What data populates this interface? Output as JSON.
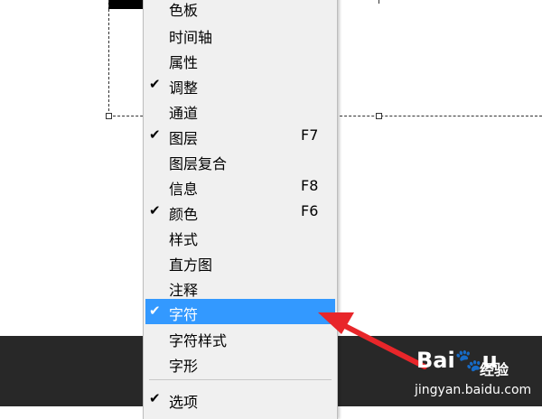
{
  "menu": {
    "items": [
      {
        "label": "色板",
        "checked": false,
        "shortcut": ""
      },
      {
        "label": "时间轴",
        "checked": false,
        "shortcut": ""
      },
      {
        "label": "属性",
        "checked": false,
        "shortcut": ""
      },
      {
        "label": "调整",
        "checked": true,
        "shortcut": ""
      },
      {
        "label": "通道",
        "checked": false,
        "shortcut": ""
      },
      {
        "label": "图层",
        "checked": true,
        "shortcut": "F7"
      },
      {
        "label": "图层复合",
        "checked": false,
        "shortcut": ""
      },
      {
        "label": "信息",
        "checked": false,
        "shortcut": "F8"
      },
      {
        "label": "颜色",
        "checked": true,
        "shortcut": "F6"
      },
      {
        "label": "样式",
        "checked": false,
        "shortcut": ""
      },
      {
        "label": "直方图",
        "checked": false,
        "shortcut": ""
      },
      {
        "label": "注释",
        "checked": false,
        "shortcut": ""
      },
      {
        "label": "字符",
        "checked": true,
        "shortcut": "",
        "highlighted": true
      },
      {
        "label": "字符样式",
        "checked": false,
        "shortcut": ""
      },
      {
        "label": "字形",
        "checked": false,
        "shortcut": ""
      },
      {
        "label": "选项",
        "checked": true,
        "shortcut": ""
      }
    ],
    "check_glyph": "✔"
  },
  "colors": {
    "highlight": "#3399ff",
    "arrow": "#e8262a",
    "dark_bar": "#282828"
  },
  "watermark": {
    "logo_left": "Bai",
    "logo_right": "u",
    "jingyan": "经验",
    "url": "jingyan.baidu.com"
  }
}
